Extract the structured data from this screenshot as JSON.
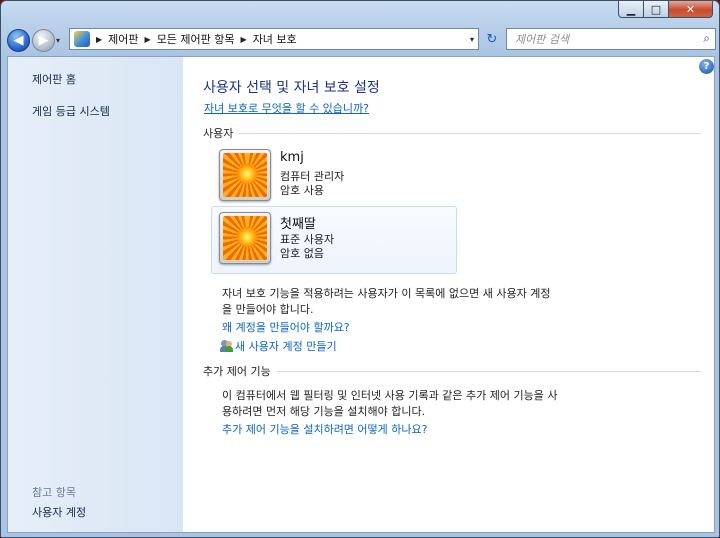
{
  "window": {
    "caption": {
      "minimize": "▁",
      "maximize": "□",
      "close": "✕"
    }
  },
  "nav": {
    "back_glyph": "◀",
    "forward_glyph": "▶",
    "dropdown_glyph": "▾",
    "breadcrumbs": [
      "제어판",
      "모든 제어판 항목",
      "자녀 보호"
    ],
    "separator": "▶",
    "refresh_glyph": "↻",
    "search_placeholder": "제어판 검색",
    "search_glyph": "⌕"
  },
  "sidebar": {
    "home": "제어판 홈",
    "game_ratings": "게임 등급 시스템",
    "see_also_heading": "참고 항목",
    "user_accounts": "사용자 계정"
  },
  "main": {
    "help_glyph": "?",
    "title": "사용자 선택 및 자녀 보호 설정",
    "what_is_link": "자녀 보호로 무엇을 할 수 있습니까?",
    "users_section": "사용자",
    "users": [
      {
        "name": "kmj",
        "role": "컴퓨터 관리자",
        "password": "암호 사용",
        "selected": false
      },
      {
        "name": "첫째딸",
        "role": "표준 사용자",
        "password": "암호 없음",
        "selected": true
      }
    ],
    "info_line1": "자녀 보호 기능을 적용하려는 사용자가 이 목록에 없으면 새 사용자 계정",
    "info_line2": "을 만들어야 합니다.",
    "why_link": "왜 계정을 만들어야 할까요?",
    "new_account_link": "새 사용자 계정 만들기",
    "extra_section": "추가 제어 기능",
    "extra_line1": "이 컴퓨터에서 웹 필터링 및 인터넷 사용 기록과 같은 추가 제어 기능을 사",
    "extra_line2": "용하려면 먼저 해당 기능을 설치해야 합니다.",
    "extra_link": "추가 제어 기능을 설치하려면 어떻게 하나요?"
  }
}
